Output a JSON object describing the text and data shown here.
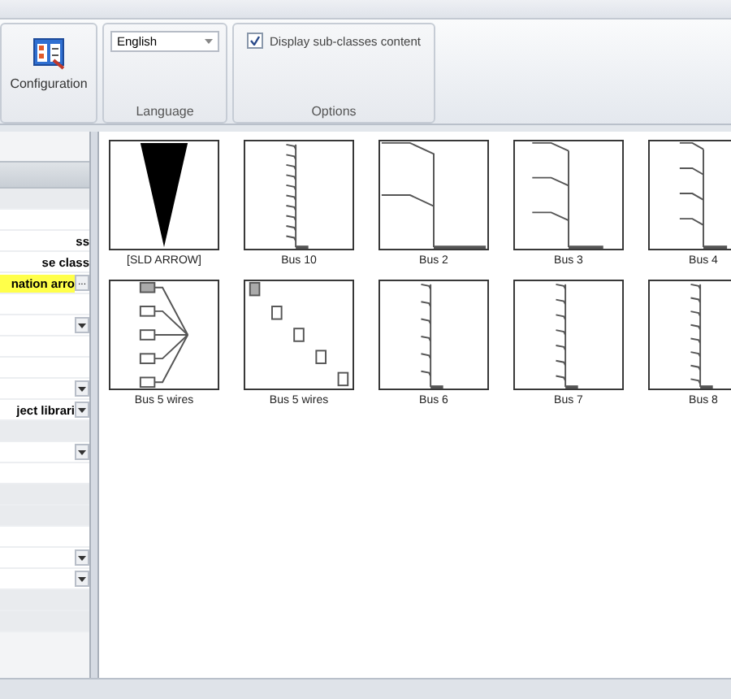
{
  "ribbon": {
    "configuration": {
      "label": "Configuration"
    },
    "language": {
      "value": "English",
      "group": "Language"
    },
    "options": {
      "label": "Display sub-classes content",
      "checked": true,
      "group": "Options"
    }
  },
  "properties": [
    {
      "kind": "gray"
    },
    {
      "kind": "blank"
    },
    {
      "kind": "text",
      "text": "ss"
    },
    {
      "kind": "text",
      "text": "se class"
    },
    {
      "kind": "highlight",
      "text": "nation arro",
      "button": "..."
    },
    {
      "kind": "blank"
    },
    {
      "kind": "dropdown"
    },
    {
      "kind": "blank"
    },
    {
      "kind": "blank"
    },
    {
      "kind": "dropdown"
    },
    {
      "kind": "dropdown",
      "text": "ject librari"
    },
    {
      "kind": "gray"
    },
    {
      "kind": "dropdown"
    },
    {
      "kind": "blank"
    },
    {
      "kind": "gray"
    },
    {
      "kind": "gray"
    },
    {
      "kind": "blank"
    },
    {
      "kind": "dropdown"
    },
    {
      "kind": "dropdown"
    },
    {
      "kind": "gray"
    },
    {
      "kind": "gray"
    }
  ],
  "gallery": [
    {
      "kind": "arrow",
      "label": "[SLD ARROW]"
    },
    {
      "kind": "bus10",
      "label": "Bus 10"
    },
    {
      "kind": "bus2",
      "label": "Bus 2"
    },
    {
      "kind": "bus3",
      "label": "Bus 3"
    },
    {
      "kind": "bus4",
      "label": "Bus 4"
    },
    {
      "kind": "wires",
      "label": "Bus 5 wires"
    },
    {
      "kind": "blocks",
      "label": "Bus 5 wires"
    },
    {
      "kind": "bus6",
      "label": "Bus 6"
    },
    {
      "kind": "bus7",
      "label": "Bus 7"
    },
    {
      "kind": "bus8",
      "label": "Bus 8"
    }
  ]
}
